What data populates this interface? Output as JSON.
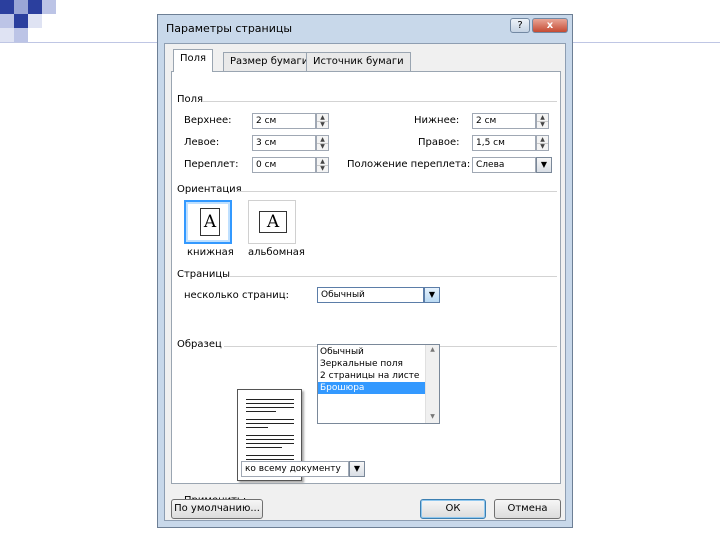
{
  "dialog": {
    "title": "Параметры страницы",
    "help_label": "?",
    "close_label": "x"
  },
  "tabs": [
    {
      "label": "Поля",
      "active": true
    },
    {
      "label": "Размер бумаги",
      "active": false
    },
    {
      "label": "Источник бумаги",
      "active": false
    }
  ],
  "margins": {
    "section_label": "Поля",
    "top_label": "Верхнее:",
    "top_value": "2 см",
    "bottom_label": "Нижнее:",
    "bottom_value": "2 см",
    "left_label": "Левое:",
    "left_value": "3 см",
    "right_label": "Правое:",
    "right_value": "1,5 см",
    "gutter_label": "Переплет:",
    "gutter_value": "0 см",
    "gutter_pos_label": "Положение переплета:",
    "gutter_pos_value": "Слева"
  },
  "orientation": {
    "section_label": "Ориентация",
    "portrait_label": "книжная",
    "landscape_label": "альбомная",
    "glyph": "A"
  },
  "pages": {
    "section_label": "Страницы",
    "multiple_label": "несколько страниц:",
    "selected_value": "Обычный",
    "options": [
      "Обычный",
      "Зеркальные поля",
      "2 страницы на листе",
      "Брошюра"
    ],
    "highlighted_index": 3
  },
  "sample": {
    "section_label": "Образец"
  },
  "apply": {
    "label": "Применить:",
    "value": "ко всему документу"
  },
  "buttons": {
    "default_label": "По умолчанию...",
    "ok_label": "ОК",
    "cancel_label": "Отмена"
  },
  "colors": {
    "frame": "#c8d8ea",
    "selection": "#3399ff",
    "close": "#c54a33",
    "deco_blue": "#2b3f9e"
  }
}
